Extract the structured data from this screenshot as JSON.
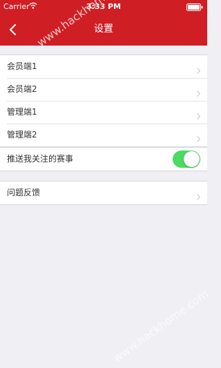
{
  "status_bar": {
    "carrier": "Carrier",
    "time": "3:33 PM"
  },
  "nav": {
    "title": "设置"
  },
  "sections": {
    "clients": [
      "会员端1",
      "会员端2",
      "管理端1",
      "管理端2"
    ],
    "push": {
      "label": "推送我关注的赛事",
      "enabled": true
    },
    "feedback": {
      "label": "问题反馈"
    }
  },
  "watermark": "www.hackhome.com",
  "colors": {
    "header": "#cf1e24",
    "toggle_on": "#4cd964",
    "background": "#efeff4"
  }
}
